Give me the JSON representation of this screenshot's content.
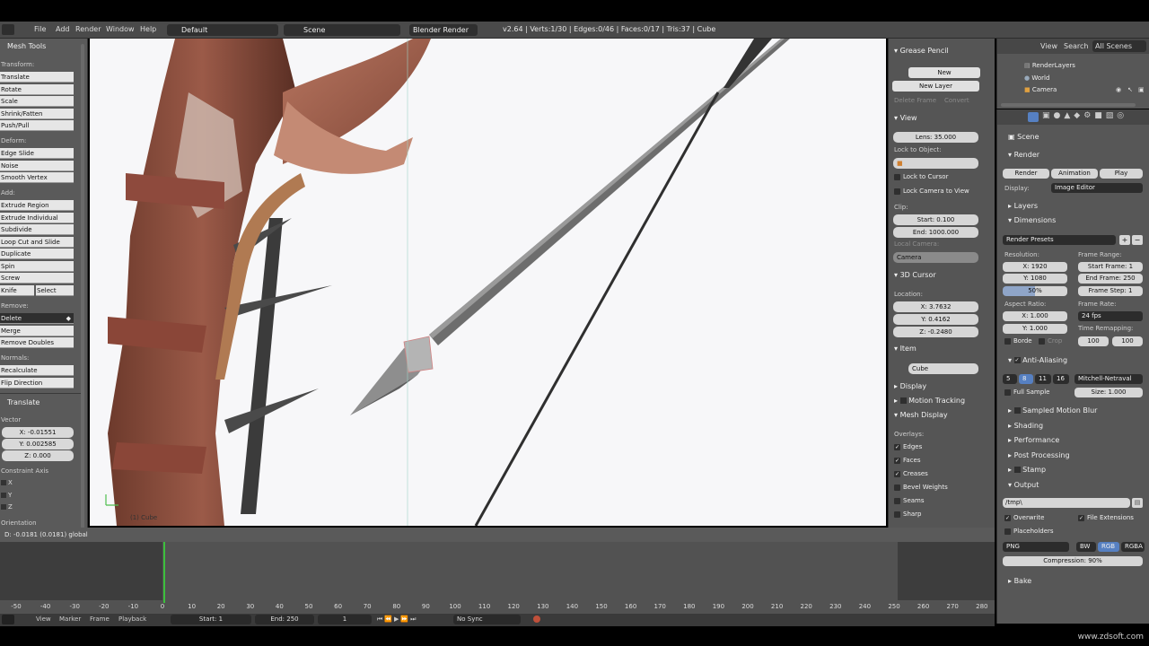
{
  "topbar": {
    "menu": [
      "File",
      "Add",
      "Render",
      "Window",
      "Help"
    ],
    "layout": "Default",
    "scene": "Scene",
    "engine": "Blender Render",
    "stats": "v2.64 | Verts:1/30 | Edges:0/46 | Faces:0/17 | Tris:37 | Cube"
  },
  "tools": {
    "title": "Mesh Tools",
    "transform_label": "Transform:",
    "transform": [
      "Translate",
      "Rotate",
      "Scale",
      "Shrink/Fatten",
      "Push/Pull"
    ],
    "deform_label": "Deform:",
    "deform": [
      "Edge Slide",
      "Noise",
      "Smooth Vertex"
    ],
    "add_label": "Add:",
    "add": [
      "Extrude Region",
      "Extrude Individual",
      "Subdivide",
      "Loop Cut and Slide",
      "Duplicate",
      "Spin",
      "Screw"
    ],
    "knife": "Knife",
    "select": "Select",
    "remove_label": "Remove:",
    "delete": "Delete",
    "remove": [
      "Merge",
      "Remove Doubles"
    ],
    "normals_label": "Normals:",
    "normals": [
      "Recalculate",
      "Flip Direction"
    ],
    "op_title": "Translate",
    "vector_label": "Vector",
    "vx": "X: -0.01551",
    "vy": "Y: 0.002585",
    "vz": "Z: 0.000",
    "constraint_label": "Constraint Axis",
    "axes": [
      "X",
      "Y",
      "Z"
    ],
    "orientation_label": "Orientation"
  },
  "viewport": {
    "object_label": "(1) Cube"
  },
  "infoline": "D: -0.0181 (0.0181) global",
  "timeline": {
    "ticks": [
      "-50",
      "-40",
      "-30",
      "-20",
      "-10",
      "0",
      "10",
      "20",
      "30",
      "40",
      "50",
      "60",
      "70",
      "80",
      "90",
      "100",
      "110",
      "120",
      "130",
      "140",
      "150",
      "160",
      "170",
      "180",
      "190",
      "200",
      "210",
      "220",
      "230",
      "240",
      "250",
      "260",
      "270",
      "280"
    ],
    "menu": [
      "View",
      "Marker",
      "Frame",
      "Playback"
    ],
    "start": "Start: 1",
    "end": "End: 250",
    "current": "1",
    "sync": "No Sync"
  },
  "nprops": {
    "grease_pencil": "Grease Pencil",
    "new": "New",
    "new_layer": "New Layer",
    "delete_frame": "Delete Frame",
    "convert": "Convert",
    "view": "View",
    "lens": "Lens: 35.000",
    "lock_to_object": "Lock to Object:",
    "lock_to_cursor": "Lock to Cursor",
    "lock_camera": "Lock Camera to View",
    "clip": "Clip:",
    "clip_start": "Start: 0.100",
    "clip_end": "End: 1000.000",
    "local_camera": "Local Camera:",
    "camera": "Camera",
    "cursor": "3D Cursor",
    "location": "Location:",
    "cx": "X: 3.7632",
    "cy": "Y: 0.4162",
    "cz": "Z: -0.2480",
    "item": "Item",
    "item_name": "Cube",
    "display": "Display",
    "motion_tracking": "Motion Tracking",
    "mesh_display": "Mesh Display",
    "overlays": "Overlays:",
    "ov_edges": "Edges",
    "ov_faces": "Faces",
    "ov_creases": "Creases",
    "ov_bevel": "Bevel Weights",
    "ov_seams": "Seams",
    "ov_sharp": "Sharp"
  },
  "outliner": {
    "view": "View",
    "search": "Search",
    "all_scenes": "All Scenes",
    "items": [
      "RenderLayers",
      "World",
      "Camera"
    ]
  },
  "properties": {
    "scene": "Scene",
    "render": "Render",
    "btn_render": "Render",
    "btn_animation": "Animation",
    "btn_play": "Play",
    "display_label": "Display:",
    "display_value": "Image Editor",
    "layers": "Layers",
    "dimensions": "Dimensions",
    "render_presets": "Render Presets",
    "resolution": "Resolution:",
    "res_x": "X: 1920",
    "res_y": "Y: 1080",
    "res_pct": "50%",
    "frame_range": "Frame Range:",
    "start_frame": "Start Frame: 1",
    "end_frame": "End Frame: 250",
    "frame_step": "Frame Step: 1",
    "aspect_ratio": "Aspect Ratio:",
    "asp_x": "X: 1.000",
    "asp_y": "Y: 1.000",
    "frame_rate": "Frame Rate:",
    "fps": "24 fps",
    "time_remapping": "Time Remapping:",
    "remap_old": "100",
    "remap_new": "100",
    "border": "Borde",
    "crop": "Crop",
    "anti_aliasing": "Anti-Aliasing",
    "aa_samples": [
      "5",
      "8",
      "11",
      "16"
    ],
    "aa_filter": "Mitchell-Netraval",
    "full_sample": "Full Sample",
    "aa_size": "Size: 1.000",
    "sampled_motion_blur": "Sampled Motion Blur",
    "shading": "Shading",
    "performance": "Performance",
    "post_processing": "Post Processing",
    "stamp": "Stamp",
    "output": "Output",
    "output_path": "/tmp\\",
    "overwrite": "Overwrite",
    "file_extensions": "File Extensions",
    "placeholders": "Placeholders",
    "format": "PNG",
    "bw": "BW",
    "rgb": "RGB",
    "rgba": "RGBA",
    "compression": "Compression: 90%",
    "bake": "Bake"
  },
  "watermark": "www.zdsoft.com"
}
